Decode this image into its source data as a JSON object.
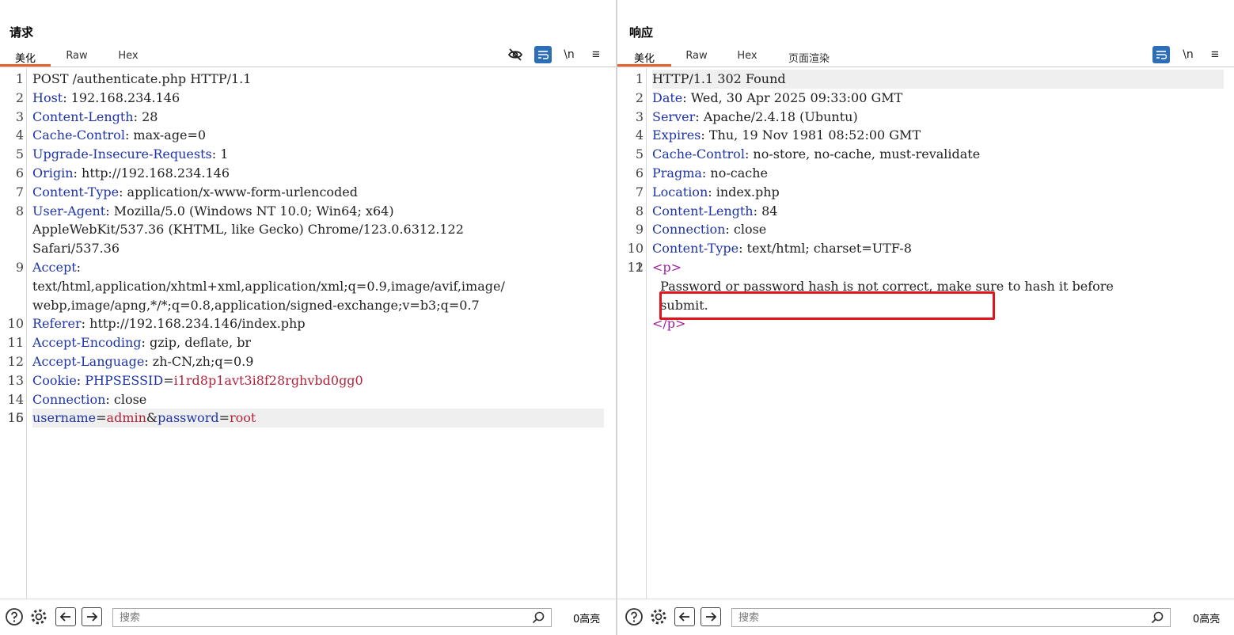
{
  "request": {
    "title": "请求",
    "tabs": [
      {
        "label": "美化",
        "active": true
      },
      {
        "label": "Raw"
      },
      {
        "label": "Hex"
      }
    ],
    "tools": {
      "newline_label": "\\n",
      "menu_label": "≡"
    },
    "lines": [
      {
        "n": "1",
        "parts": [
          [
            "v",
            "POST /authenticate.php HTTP/1.1"
          ]
        ]
      },
      {
        "n": "2",
        "parts": [
          [
            "k",
            "Host"
          ],
          [
            "v",
            ": 192.168.234.146"
          ]
        ]
      },
      {
        "n": "3",
        "parts": [
          [
            "k",
            "Content-Length"
          ],
          [
            "v",
            ": 28"
          ]
        ]
      },
      {
        "n": "4",
        "parts": [
          [
            "k",
            "Cache-Control"
          ],
          [
            "v",
            ": max-age=0"
          ]
        ]
      },
      {
        "n": "5",
        "parts": [
          [
            "k",
            "Upgrade-Insecure-Requests"
          ],
          [
            "v",
            ": 1"
          ]
        ]
      },
      {
        "n": "6",
        "parts": [
          [
            "k",
            "Origin"
          ],
          [
            "v",
            ": http://192.168.234.146"
          ]
        ]
      },
      {
        "n": "7",
        "parts": [
          [
            "k",
            "Content-Type"
          ],
          [
            "v",
            ": application/x-www-form-urlencoded"
          ]
        ]
      },
      {
        "n": "8",
        "parts": [
          [
            "k",
            "User-Agent"
          ],
          [
            "v",
            ": Mozilla/5.0 (Windows NT 10.0; Win64; x64)"
          ]
        ]
      },
      {
        "n": "",
        "parts": [
          [
            "v",
            "AppleWebKit/537.36 (KHTML, like Gecko) Chrome/123.0.6312.122"
          ]
        ]
      },
      {
        "n": "",
        "parts": [
          [
            "v",
            "Safari/537.36"
          ]
        ]
      },
      {
        "n": "9",
        "parts": [
          [
            "k",
            "Accept"
          ],
          [
            "v",
            ":"
          ]
        ]
      },
      {
        "n": "",
        "parts": [
          [
            "v",
            "text/html,application/xhtml+xml,application/xml;q=0.9,image/avif,image/"
          ]
        ]
      },
      {
        "n": "",
        "parts": [
          [
            "v",
            "webp,image/apng,*/*;q=0.8,application/signed-exchange;v=b3;q=0.7"
          ]
        ]
      },
      {
        "n": "10",
        "parts": [
          [
            "k",
            "Referer"
          ],
          [
            "v",
            ": http://192.168.234.146/index.php"
          ]
        ]
      },
      {
        "n": "11",
        "parts": [
          [
            "k",
            "Accept-Encoding"
          ],
          [
            "v",
            ": gzip, deflate, br"
          ]
        ]
      },
      {
        "n": "12",
        "parts": [
          [
            "k",
            "Accept-Language"
          ],
          [
            "v",
            ": zh-CN,zh;q=0.9"
          ]
        ]
      },
      {
        "n": "13",
        "parts": [
          [
            "k",
            "Cookie"
          ],
          [
            "v",
            ": "
          ],
          [
            "k",
            "PHPSESSID"
          ],
          [
            "v",
            "="
          ],
          [
            "cv",
            "i1rd8p1avt3i8f28rghvbd0gg0"
          ]
        ]
      },
      {
        "n": "14",
        "parts": [
          [
            "k",
            "Connection"
          ],
          [
            "v",
            ": close"
          ]
        ]
      },
      {
        "n": "15",
        "parts": [
          [
            "v",
            ""
          ]
        ]
      },
      {
        "n": "16",
        "hl": true,
        "parts": [
          [
            "k",
            "username"
          ],
          [
            "v",
            "="
          ],
          [
            "cv",
            "admin"
          ],
          [
            "v",
            "&"
          ],
          [
            "k",
            "password"
          ],
          [
            "v",
            "="
          ],
          [
            "cv",
            "root"
          ]
        ]
      }
    ],
    "search_placeholder": "搜索",
    "hits": "0高亮"
  },
  "response": {
    "title": "响应",
    "tabs": [
      {
        "label": "美化",
        "active": true
      },
      {
        "label": "Raw"
      },
      {
        "label": "Hex"
      },
      {
        "label": "页面渲染"
      }
    ],
    "tools": {
      "newline_label": "\\n",
      "menu_label": "≡"
    },
    "lines": [
      {
        "n": "1",
        "hl": true,
        "parts": [
          [
            "v",
            "HTTP/1.1 302 Found"
          ]
        ]
      },
      {
        "n": "2",
        "parts": [
          [
            "k",
            "Date"
          ],
          [
            "v",
            ": Wed, 30 Apr 2025 09:33:00 GMT"
          ]
        ]
      },
      {
        "n": "3",
        "parts": [
          [
            "k",
            "Server"
          ],
          [
            "v",
            ": Apache/2.4.18 (Ubuntu)"
          ]
        ]
      },
      {
        "n": "4",
        "parts": [
          [
            "k",
            "Expires"
          ],
          [
            "v",
            ": Thu, 19 Nov 1981 08:52:00 GMT"
          ]
        ]
      },
      {
        "n": "5",
        "parts": [
          [
            "k",
            "Cache-Control"
          ],
          [
            "v",
            ": no-store, no-cache, must-revalidate"
          ]
        ]
      },
      {
        "n": "6",
        "parts": [
          [
            "k",
            "Pragma"
          ],
          [
            "v",
            ": no-cache"
          ]
        ]
      },
      {
        "n": "7",
        "parts": [
          [
            "k",
            "Location"
          ],
          [
            "v",
            ": index.php"
          ]
        ]
      },
      {
        "n": "8",
        "parts": [
          [
            "k",
            "Content-Length"
          ],
          [
            "v",
            ": 84"
          ]
        ]
      },
      {
        "n": "9",
        "parts": [
          [
            "k",
            "Connection"
          ],
          [
            "v",
            ": close"
          ]
        ]
      },
      {
        "n": "10",
        "parts": [
          [
            "k",
            "Content-Type"
          ],
          [
            "v",
            ": text/html; charset=UTF-8"
          ]
        ]
      },
      {
        "n": "11",
        "parts": [
          [
            "v",
            ""
          ]
        ]
      },
      {
        "n": "12",
        "parts": [
          [
            "tag",
            "<p>"
          ]
        ]
      },
      {
        "n": "",
        "parts": [
          [
            "v",
            "  Password or password hash is not correct, make sure to hash it before"
          ]
        ]
      },
      {
        "n": "",
        "parts": [
          [
            "v",
            "  submit."
          ]
        ]
      },
      {
        "n": "",
        "parts": [
          [
            "tag",
            "</p>"
          ]
        ]
      }
    ],
    "search_placeholder": "搜索",
    "hits": "0高亮"
  },
  "colors": {
    "accent": "#2d6fb7",
    "tab_underline": "#e8632b",
    "header_key": "#1e34a8",
    "cookie_value": "#b0243b",
    "html_tag": "#a020a0",
    "annotation": "#e2131c"
  }
}
